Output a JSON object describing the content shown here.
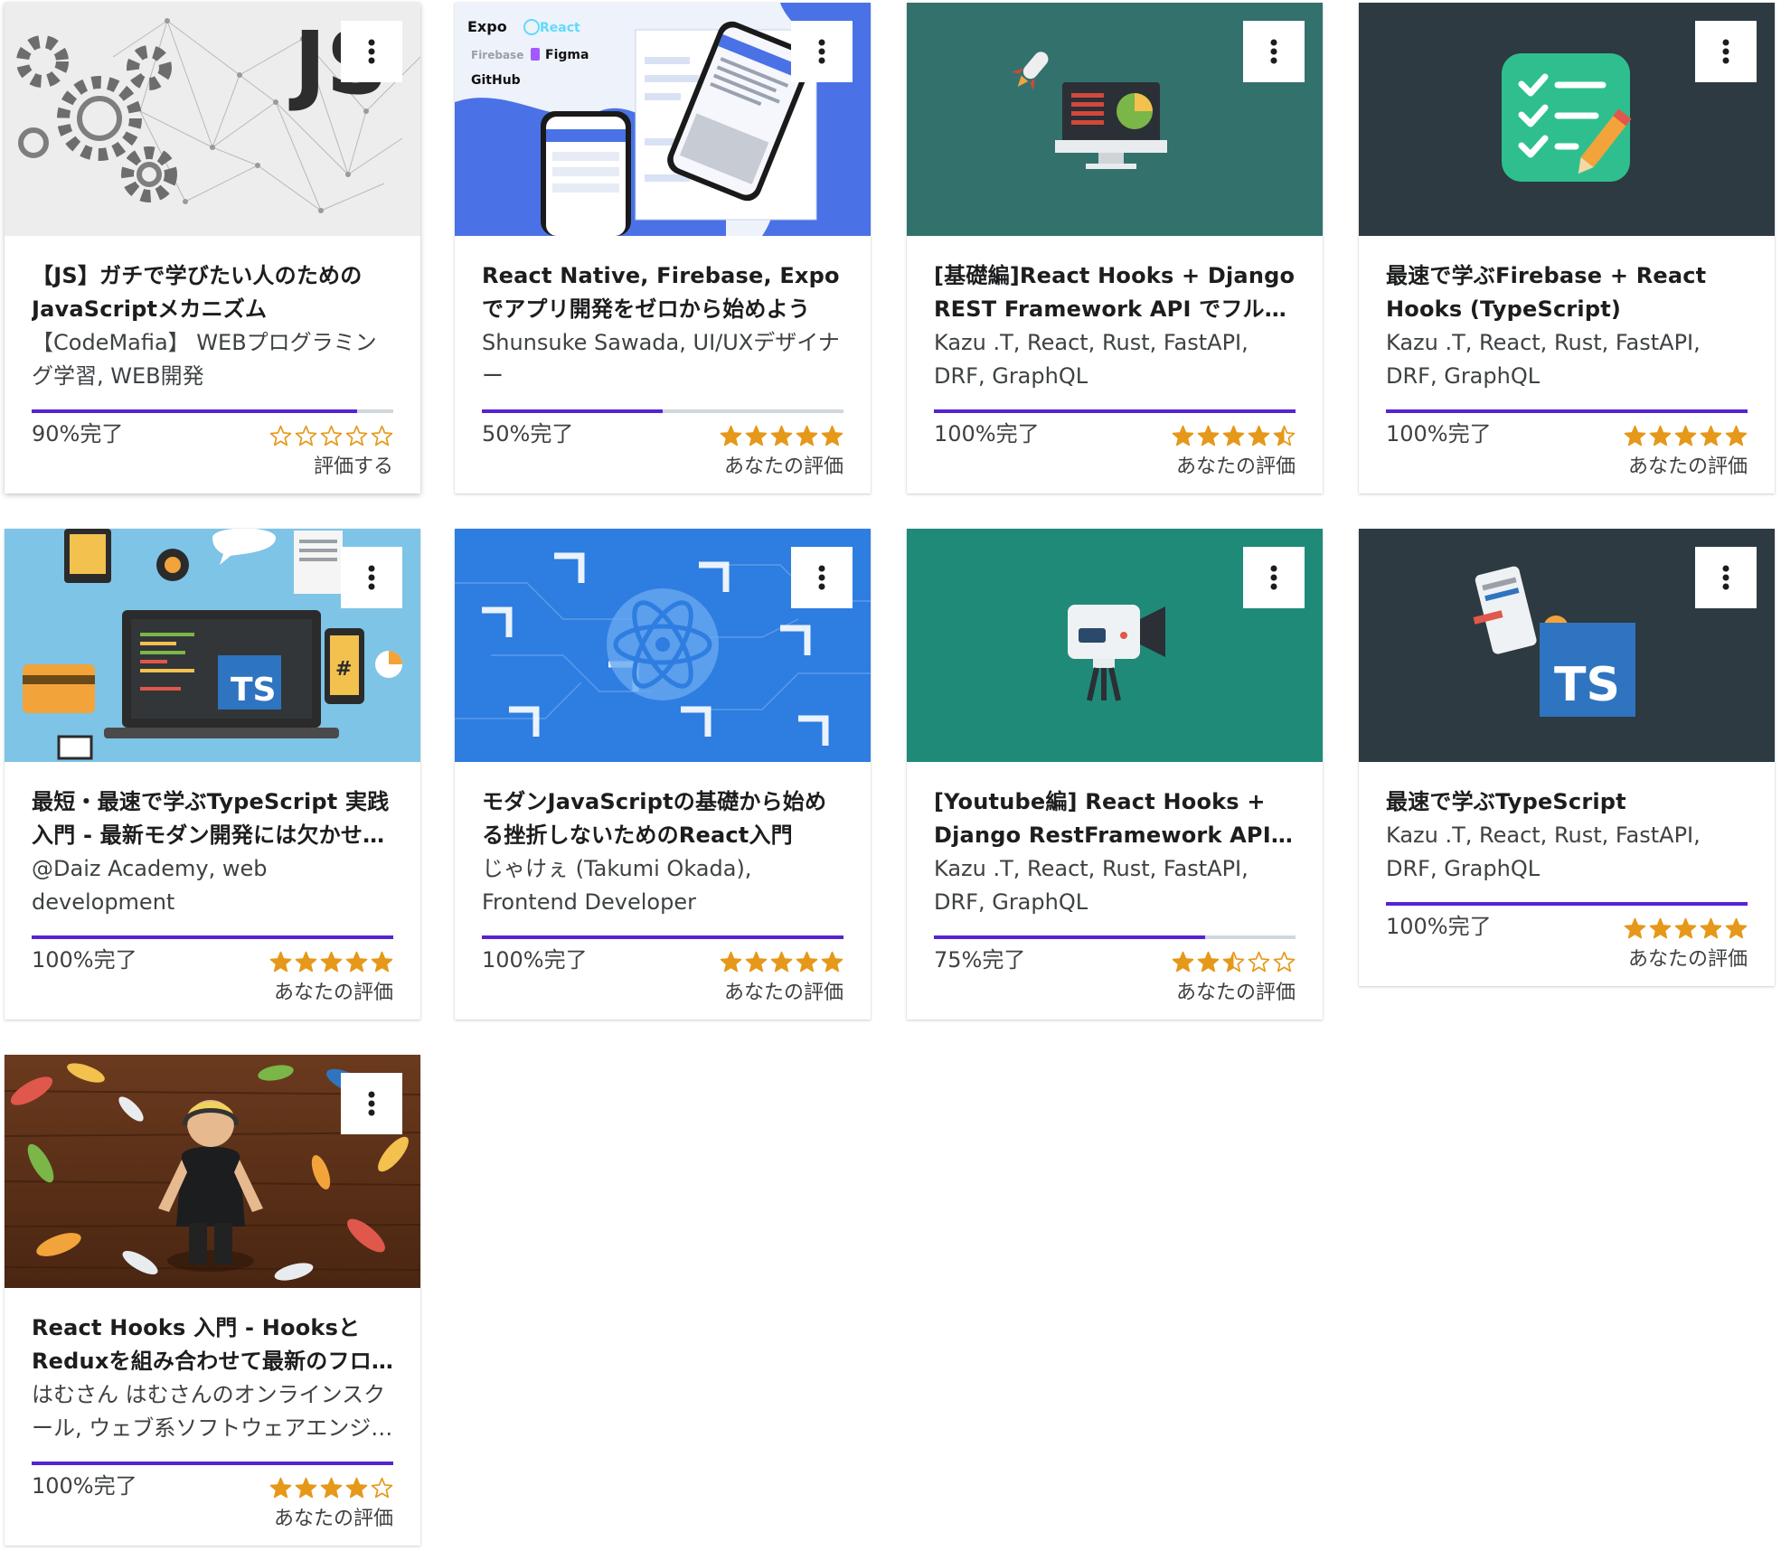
{
  "courses": [
    {
      "title": "【JS】ガチで学びたい人のためのJavaScriptメカニズム",
      "instructor": "【CodeMafia】 WEBプログラミング学習, WEB開発",
      "progress_label": "90%完了",
      "progress": 0.9,
      "rating": 0,
      "rating_label": "評価する",
      "thumbnail_text": "JS"
    },
    {
      "title": "React Native, Firebase, Expoでアプリ開発をゼロから始めよう",
      "instructor": "Shunsuke Sawada, UI/UXデザイナー",
      "progress_label": "50%完了",
      "progress": 0.5,
      "rating": 5,
      "rating_label": "あなたの評価",
      "thumbnail_labels": [
        "Expo",
        "React",
        "Firebase",
        "Figma",
        "GitHub"
      ]
    },
    {
      "title": "[基礎編]React Hooks + Django REST Framework API でフルスタック",
      "instructor": "Kazu .T, React, Rust, FastAPI, DRF, GraphQL",
      "progress_label": "100%完了",
      "progress": 1.0,
      "rating": 4.5,
      "rating_label": "あなたの評価"
    },
    {
      "title": "最速で学ぶFirebase + React Hooks (TypeScript)",
      "instructor": "Kazu .T, React, Rust, FastAPI, DRF, GraphQL",
      "progress_label": "100%完了",
      "progress": 1.0,
      "rating": 5,
      "rating_label": "あなたの評価"
    },
    {
      "title": "最短・最速で学ぶTypeScript 実践入門 - 最新モダン開発には欠かせない",
      "instructor": "@Daiz Academy, web development",
      "progress_label": "100%完了",
      "progress": 1.0,
      "rating": 5,
      "rating_label": "あなたの評価",
      "thumbnail_text": "TS"
    },
    {
      "title": "モダンJavaScriptの基礎から始める挫折しないためのReact入門",
      "instructor": "じゃけぇ (Takumi Okada), Frontend Developer",
      "progress_label": "100%完了",
      "progress": 1.0,
      "rating": 5,
      "rating_label": "あなたの評価"
    },
    {
      "title": "[Youtube編] React Hooks + Django RestFramework API でフルスタック",
      "instructor": "Kazu .T, React, Rust, FastAPI, DRF, GraphQL",
      "progress_label": "75%完了",
      "progress": 0.75,
      "rating": 2.5,
      "rating_label": "あなたの評価"
    },
    {
      "title": "最速で学ぶTypeScript",
      "instructor": "Kazu .T, React, Rust, FastAPI, DRF, GraphQL",
      "progress_label": "100%完了",
      "progress": 1.0,
      "rating": 5,
      "rating_label": "あなたの評価",
      "thumbnail_text": "TS"
    },
    {
      "title": "React Hooks 入門 - HooksとReduxを組み合わせて最新のフロントエンド",
      "instructor": "はむさん はむさんのオンラインスクール, ウェブ系ソフトウェアエンジニア",
      "progress_label": "100%完了",
      "progress": 1.0,
      "rating": 4,
      "rating_label": "あなたの評価"
    }
  ],
  "colors": {
    "progress": "#5624d0",
    "star": "#e59819",
    "track": "#d1d7dc"
  },
  "icons": {
    "menu": "more-vertical-icon",
    "star": "star-icon"
  }
}
